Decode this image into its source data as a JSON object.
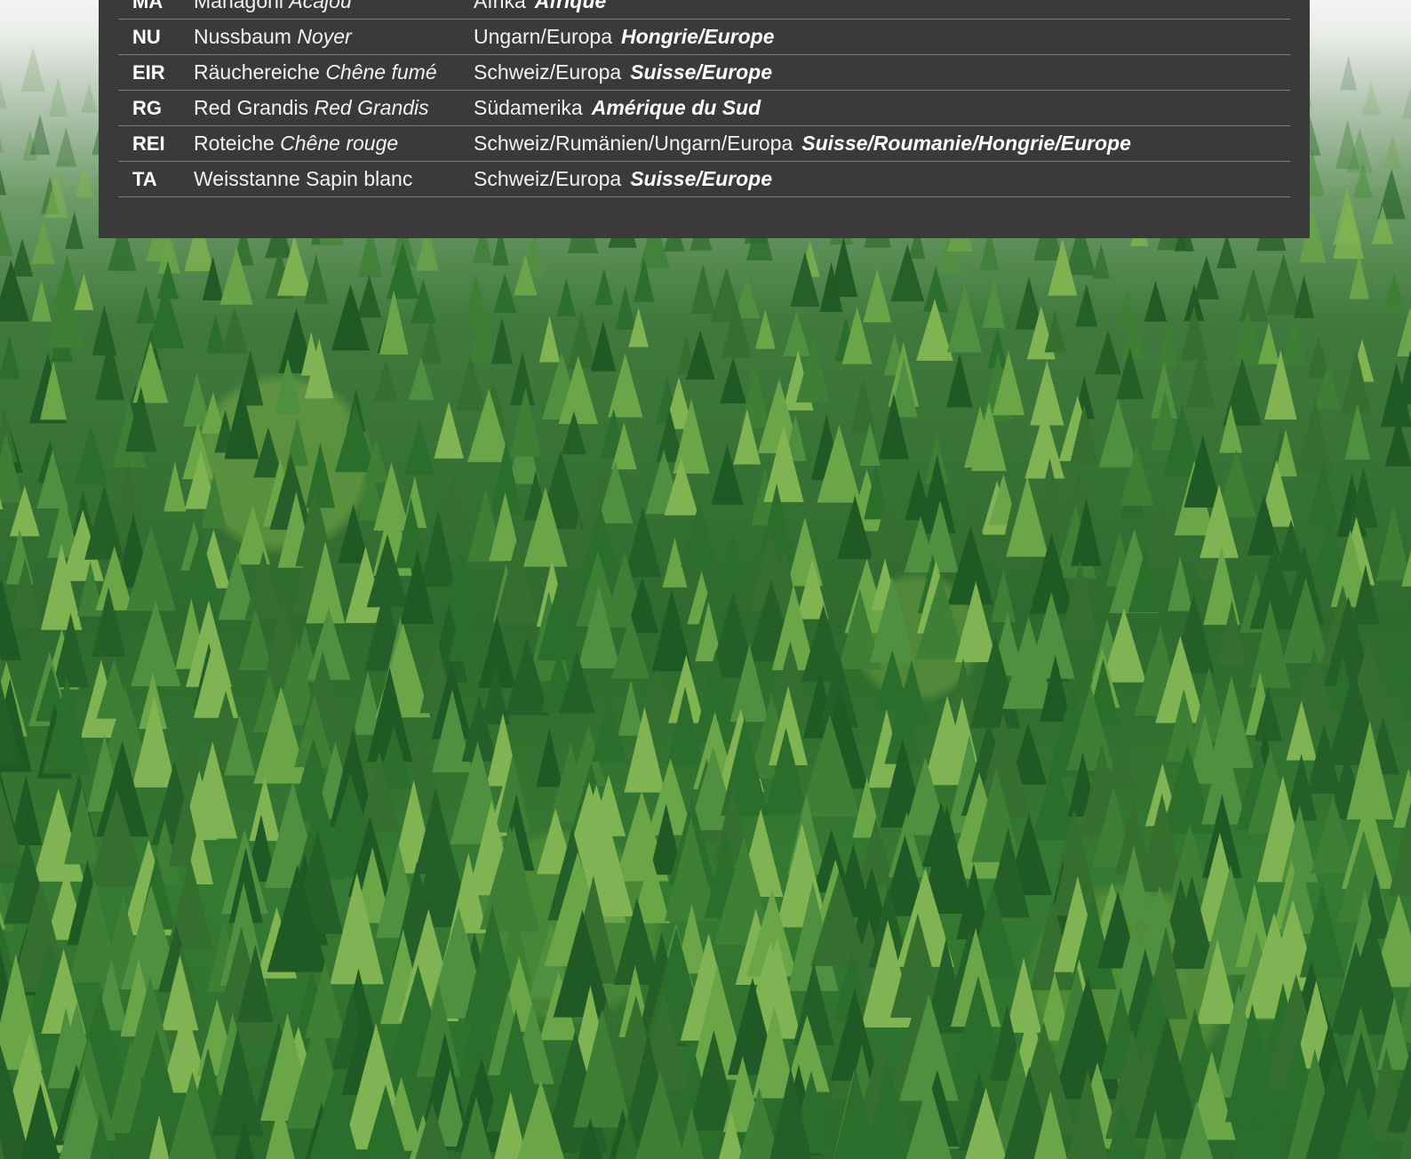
{
  "table": {
    "rows": [
      {
        "code": "MA",
        "name_de": "Mahagoni",
        "name_fr": "Acajou",
        "origin_de": "Afrika",
        "origin_fr": "Afrique"
      },
      {
        "code": "NU",
        "name_de": "Nussbaum",
        "name_fr": "Noyer",
        "origin_de": "Ungarn/Europa",
        "origin_fr": "Hongrie/Europe"
      },
      {
        "code": "EIR",
        "name_de": "Räuchereiche",
        "name_fr": "Chêne fumé",
        "origin_de": "Schweiz/Europa",
        "origin_fr": "Suisse/Europe"
      },
      {
        "code": "RG",
        "name_de": "Red Grandis",
        "name_fr": "Red Grandis",
        "origin_de": "Südamerika",
        "origin_fr": "Amérique du Sud"
      },
      {
        "code": "REI",
        "name_de": "Roteiche",
        "name_fr": "Chêne rouge",
        "origin_de": "Schweiz/Rumänien/Ungarn/Europa",
        "origin_fr": "Suisse/Roumanie/Hongrie/Europe"
      },
      {
        "code": "TA",
        "name_de": "Weisstanne Sapin blanc",
        "name_fr": "",
        "origin_de": "Schweiz/Europa",
        "origin_fr": "Suisse/Europe"
      }
    ]
  },
  "colors": {
    "panel_background": "#3a3a3a",
    "row_divider": "#d0643a",
    "text": "#ffffff"
  }
}
